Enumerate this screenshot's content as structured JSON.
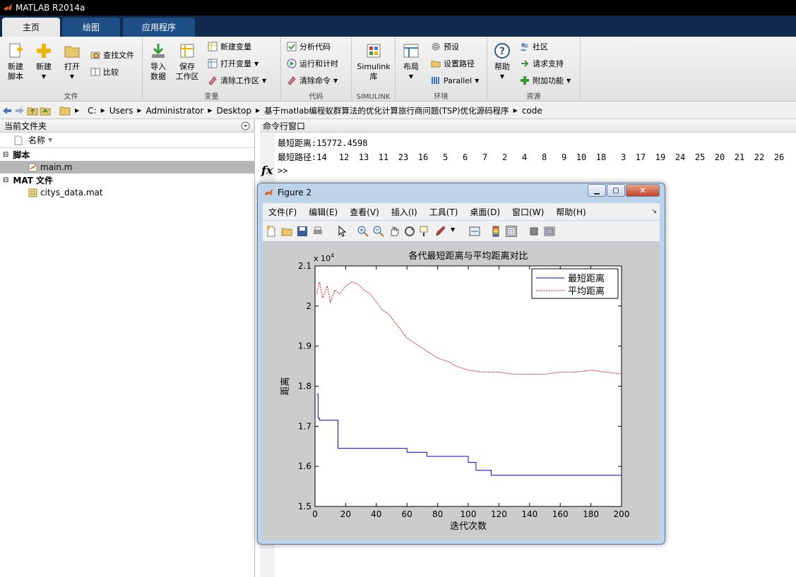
{
  "app": {
    "title": "MATLAB R2014a"
  },
  "tabs": [
    {
      "label": "主页"
    },
    {
      "label": "绘图"
    },
    {
      "label": "应用程序"
    }
  ],
  "ribbon": {
    "file": {
      "name": "文件",
      "new_script": [
        "新建",
        "脚本"
      ],
      "new": "新建",
      "open": "打开",
      "find_files": "查找文件",
      "compare": "比较"
    },
    "variable": {
      "name": "变量",
      "import": [
        "导入",
        "数据"
      ],
      "save": [
        "保存",
        "工作区"
      ],
      "new_var": "新建变量",
      "open_var": "打开变量",
      "clear_ws": "清除工作区"
    },
    "code": {
      "name": "代码",
      "analyze": "分析代码",
      "run_time": "运行和计时",
      "clear_cmd": "清除命令"
    },
    "simulink": {
      "name": "SIMULINK",
      "lib": [
        "Simulink",
        "库"
      ]
    },
    "env": {
      "name": "环境",
      "layout": "布局",
      "prefs": "预设",
      "set_path": "设置路径",
      "parallel": "Parallel"
    },
    "resources": {
      "name": "资源",
      "help": "帮助",
      "community": "社区",
      "support": "请求支持",
      "addons": "附加功能"
    }
  },
  "address": {
    "crumbs": [
      "C:",
      "Users",
      "Administrator",
      "Desktop",
      "基于matlab编程蚁群算法的优化计算旅行商问题(TSP)优化源码程序",
      "code"
    ]
  },
  "current_folder": {
    "title": "当前文件夹",
    "col_name": "名称",
    "groups": [
      {
        "label": "脚本",
        "files": [
          {
            "name": "main.m"
          }
        ]
      },
      {
        "label": "MAT 文件",
        "files": [
          {
            "name": "citys_data.mat"
          }
        ]
      }
    ]
  },
  "command_window": {
    "title": "命令行窗口",
    "line1": "最短距离:15772.4598",
    "route_label": "最短路径:",
    "route": [
      "14",
      "12",
      "13",
      "11",
      "23",
      "16",
      "5",
      "6",
      "7",
      "2",
      "4",
      "8",
      "9",
      "10",
      "18",
      "3",
      "17",
      "19",
      "24",
      "25",
      "20",
      "21",
      "22",
      "26"
    ],
    "fx": "fx",
    "prompt": ">>"
  },
  "figure": {
    "title": "Figure 2",
    "menu": [
      "文件(F)",
      "编辑(E)",
      "查看(V)",
      "插入(I)",
      "工具(T)",
      "桌面(D)",
      "窗口(W)",
      "帮助(H)"
    ]
  },
  "chart_data": {
    "type": "line",
    "title": "各代最短距离与平均距离对比",
    "xlabel": "迭代次数",
    "ylabel": "距离",
    "y_multiplier": "x 10",
    "y_exponent": "4",
    "xlim": [
      0,
      200
    ],
    "ylim": [
      1.5,
      2.1
    ],
    "xticks": [
      0,
      20,
      40,
      60,
      80,
      100,
      120,
      140,
      160,
      180,
      200
    ],
    "yticks": [
      "1.5",
      "1.6",
      "1.7",
      "1.8",
      "1.9",
      "2",
      "2.1"
    ],
    "legend_position": "top-right",
    "series": [
      {
        "name": "最短距离",
        "style": "solid",
        "color": "#0000ff",
        "points": [
          [
            1,
            1.78
          ],
          [
            2,
            1.72
          ],
          [
            3,
            1.715
          ],
          [
            14,
            1.715
          ],
          [
            15,
            1.645
          ],
          [
            55,
            1.645
          ],
          [
            60,
            1.635
          ],
          [
            72,
            1.635
          ],
          [
            73,
            1.625
          ],
          [
            97,
            1.625
          ],
          [
            100,
            1.61
          ],
          [
            104,
            1.61
          ],
          [
            105,
            1.59
          ],
          [
            114,
            1.59
          ],
          [
            115,
            1.578
          ],
          [
            200,
            1.578
          ]
        ]
      },
      {
        "name": "平均距离",
        "style": "dashed",
        "color": "#ff0000",
        "points": [
          [
            1,
            2.03
          ],
          [
            3,
            2.06
          ],
          [
            5,
            2.02
          ],
          [
            8,
            2.05
          ],
          [
            10,
            2.01
          ],
          [
            13,
            2.04
          ],
          [
            16,
            2.03
          ],
          [
            20,
            2.05
          ],
          [
            24,
            2.06
          ],
          [
            28,
            2.055
          ],
          [
            32,
            2.04
          ],
          [
            36,
            2.03
          ],
          [
            40,
            2.01
          ],
          [
            44,
            1.99
          ],
          [
            48,
            1.98
          ],
          [
            52,
            1.96
          ],
          [
            56,
            1.94
          ],
          [
            60,
            1.92
          ],
          [
            64,
            1.91
          ],
          [
            68,
            1.9
          ],
          [
            72,
            1.89
          ],
          [
            76,
            1.88
          ],
          [
            80,
            1.87
          ],
          [
            84,
            1.865
          ],
          [
            88,
            1.86
          ],
          [
            92,
            1.85
          ],
          [
            96,
            1.845
          ],
          [
            100,
            1.84
          ],
          [
            110,
            1.835
          ],
          [
            120,
            1.835
          ],
          [
            130,
            1.83
          ],
          [
            140,
            1.83
          ],
          [
            150,
            1.83
          ],
          [
            160,
            1.835
          ],
          [
            170,
            1.835
          ],
          [
            180,
            1.84
          ],
          [
            190,
            1.835
          ],
          [
            200,
            1.83
          ]
        ]
      }
    ]
  }
}
